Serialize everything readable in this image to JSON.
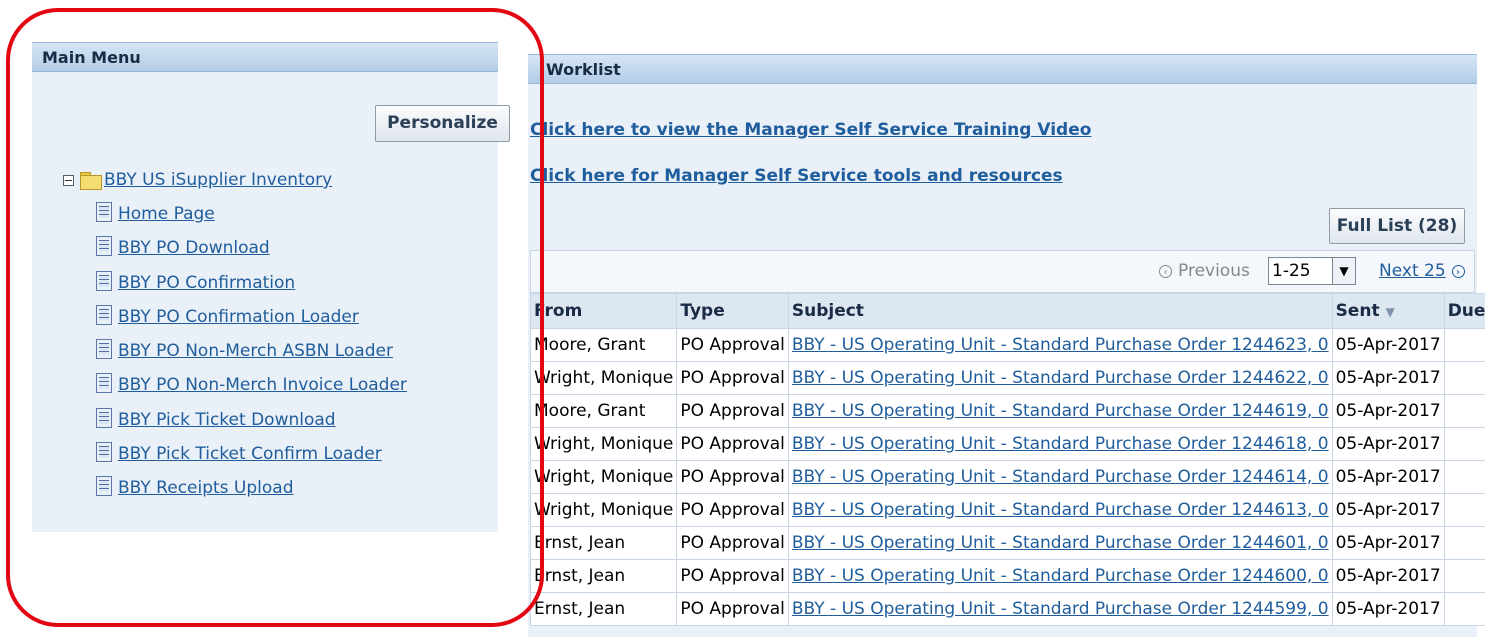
{
  "main_menu": {
    "title": "Main Menu",
    "personalize_label": "Personalize",
    "root": {
      "label": "BBY US iSupplier Inventory",
      "icon": "folder-icon",
      "expanded": true
    },
    "items": [
      {
        "label": "Home Page",
        "icon": "document-icon"
      },
      {
        "label": "BBY PO Download",
        "icon": "document-icon"
      },
      {
        "label": "BBY PO Confirmation",
        "icon": "document-icon"
      },
      {
        "label": "BBY PO Confirmation Loader",
        "icon": "document-icon"
      },
      {
        "label": "BBY PO Non-Merch ASBN Loader",
        "icon": "document-icon"
      },
      {
        "label": "BBY PO Non-Merch Invoice Loader",
        "icon": "document-icon"
      },
      {
        "label": "BBY Pick Ticket Download",
        "icon": "document-icon"
      },
      {
        "label": "BBY Pick Ticket Confirm Loader",
        "icon": "document-icon"
      },
      {
        "label": "BBY Receipts Upload",
        "icon": "document-icon"
      }
    ]
  },
  "worklist": {
    "title": "Worklist",
    "links": [
      "Click here to view the Manager Self Service Training Video",
      "Click here for Manager Self Service tools and resources"
    ],
    "full_list_label": "Full List (28)",
    "nav": {
      "previous_label": "Previous",
      "range_value": "1-25",
      "next_label": "Next 25"
    },
    "columns": [
      "From",
      "Type",
      "Subject",
      "Sent",
      "Due"
    ],
    "rows": [
      {
        "from": "Moore, Grant",
        "type": "PO Approval",
        "subject": "BBY - US Operating Unit - Standard Purchase Order 1244623, 0",
        "sent": "05-Apr-2017",
        "due": ""
      },
      {
        "from": "Wright, Monique",
        "type": "PO Approval",
        "subject": "BBY - US Operating Unit - Standard Purchase Order 1244622, 0",
        "sent": "05-Apr-2017",
        "due": ""
      },
      {
        "from": "Moore, Grant",
        "type": "PO Approval",
        "subject": "BBY - US Operating Unit - Standard Purchase Order 1244619, 0",
        "sent": "05-Apr-2017",
        "due": ""
      },
      {
        "from": "Wright, Monique",
        "type": "PO Approval",
        "subject": "BBY - US Operating Unit - Standard Purchase Order 1244618, 0",
        "sent": "05-Apr-2017",
        "due": ""
      },
      {
        "from": "Wright, Monique",
        "type": "PO Approval",
        "subject": "BBY - US Operating Unit - Standard Purchase Order 1244614, 0",
        "sent": "05-Apr-2017",
        "due": ""
      },
      {
        "from": "Wright, Monique",
        "type": "PO Approval",
        "subject": "BBY - US Operating Unit - Standard Purchase Order 1244613, 0",
        "sent": "05-Apr-2017",
        "due": ""
      },
      {
        "from": "Ernst, Jean",
        "type": "PO Approval",
        "subject": "BBY - US Operating Unit - Standard Purchase Order 1244601, 0",
        "sent": "05-Apr-2017",
        "due": ""
      },
      {
        "from": "Ernst, Jean",
        "type": "PO Approval",
        "subject": "BBY - US Operating Unit - Standard Purchase Order 1244600, 0",
        "sent": "05-Apr-2017",
        "due": ""
      },
      {
        "from": "Ernst, Jean",
        "type": "PO Approval",
        "subject": "BBY - US Operating Unit - Standard Purchase Order 1244599, 0",
        "sent": "05-Apr-2017",
        "due": ""
      }
    ]
  },
  "colors": {
    "link": "#1f5d9c",
    "panel_bg": "#eaf0f8",
    "annotation": "#e30613"
  }
}
